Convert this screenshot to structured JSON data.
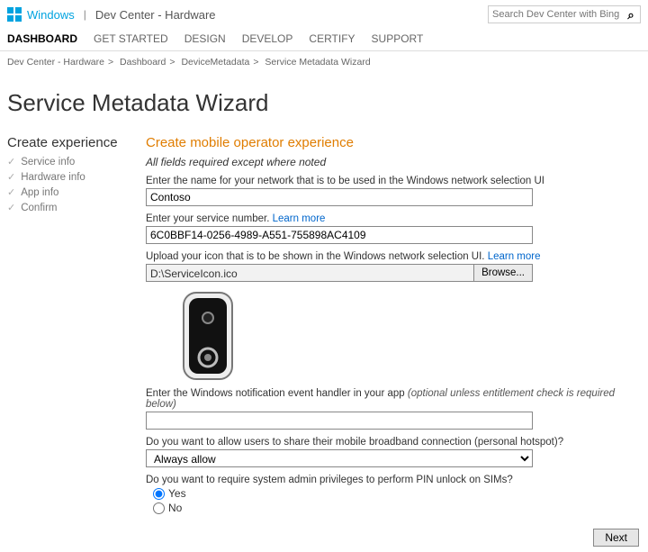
{
  "header": {
    "brand_windows": "Windows",
    "brand_section": "Dev Center - Hardware",
    "search_placeholder": "Search Dev Center with Bing"
  },
  "nav": {
    "items": [
      "DASHBOARD",
      "GET STARTED",
      "DESIGN",
      "DEVELOP",
      "CERTIFY",
      "SUPPORT"
    ],
    "active_index": 0
  },
  "breadcrumbs": {
    "items": [
      "Dev Center - Hardware",
      "Dashboard",
      "DeviceMetadata",
      "Service Metadata Wizard"
    ]
  },
  "page": {
    "title": "Service Metadata Wizard"
  },
  "sidebar": {
    "title": "Create experience",
    "steps": [
      "Service info",
      "Hardware info",
      "App info",
      "Confirm"
    ]
  },
  "main": {
    "title": "Create mobile operator experience",
    "required_note": "All fields required except where noted",
    "network_name": {
      "label": "Enter the name for your network that is to be used in the Windows network selection UI",
      "value": "Contoso"
    },
    "service_number": {
      "label_pre": "Enter your service number. ",
      "learn_more": "Learn more",
      "value": "6C0BBF14-0256-4989-A551-755898AC4109"
    },
    "icon": {
      "label_pre": "Upload your icon that is to be shown in the Windows network selection UI. ",
      "learn_more": "Learn more",
      "path": "D:\\ServiceIcon.ico",
      "browse": "Browse..."
    },
    "notification_handler": {
      "label_pre": "Enter the Windows notification event handler in your app ",
      "optional": "(optional unless entitlement check is required below)",
      "value": ""
    },
    "hotspot": {
      "label": "Do you want to allow users to share their mobile broadband connection (personal hotspot)?",
      "selected": "Always allow"
    },
    "pin_unlock": {
      "label": "Do you want to require system admin privileges to perform PIN unlock on SIMs?",
      "yes": "Yes",
      "no": "No"
    }
  },
  "footer": {
    "next": "Next"
  }
}
